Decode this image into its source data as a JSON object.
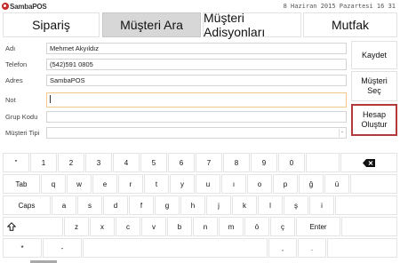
{
  "brand": {
    "name": "SambaPOS",
    "accent": "#c8292b"
  },
  "datetime": "8 Haziran 2015 Pazartesi 16 31",
  "tabs": [
    {
      "label": "Sipariş",
      "active": false
    },
    {
      "label": "Müşteri Ara",
      "active": true
    },
    {
      "label": "Müşteri Adisyonları",
      "active": false
    },
    {
      "label": "Mutfak",
      "active": false
    }
  ],
  "form": {
    "name": {
      "label": "Adı",
      "value": "Mehmet Akyıldız"
    },
    "phone": {
      "label": "Telefon",
      "value": "(542)591 0805"
    },
    "address": {
      "label": "Adres",
      "value": "SambaPOS"
    },
    "note": {
      "label": "Not",
      "value": ""
    },
    "group": {
      "label": "Grup Kodu",
      "value": ""
    },
    "type": {
      "label": "Müşteri Tipi",
      "value": ""
    }
  },
  "actions": {
    "save": "Kaydet",
    "select_customer": "Müşteri Seç",
    "create_account": "Hesap Oluştur"
  },
  "keyboard": {
    "row1": [
      "\"",
      "1",
      "2",
      "3",
      "4",
      "5",
      "6",
      "7",
      "8",
      "9",
      "0"
    ],
    "row2": [
      "Tab",
      "q",
      "w",
      "e",
      "r",
      "t",
      "y",
      "u",
      "ı",
      "o",
      "p",
      "ğ",
      "ü"
    ],
    "row3": [
      "Caps",
      "a",
      "s",
      "d",
      "f",
      "g",
      "h",
      "j",
      "k",
      "l",
      "ş",
      "i"
    ],
    "row4": [
      "z",
      "x",
      "c",
      "v",
      "b",
      "n",
      "m",
      "ö",
      "ç",
      "Enter"
    ],
    "row5": [
      "*",
      "-",
      ",",
      "."
    ]
  },
  "colors": {
    "active_tab": "#d7d7d7",
    "focus_border": "#f2c98a",
    "highlight_border": "#b23a3a"
  }
}
